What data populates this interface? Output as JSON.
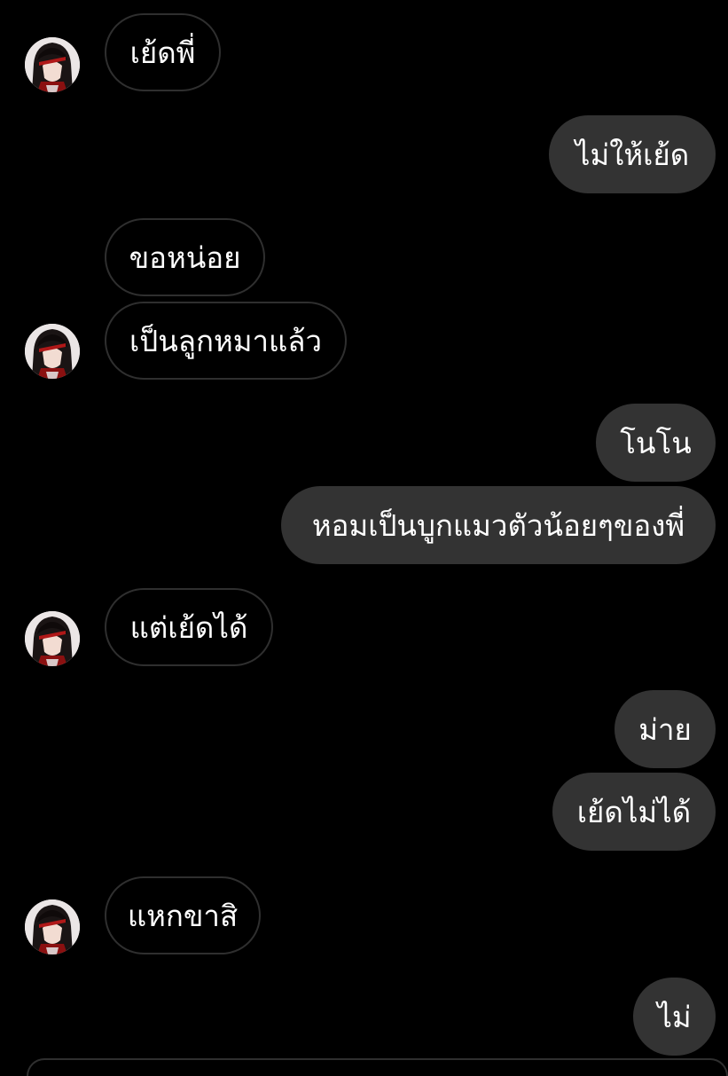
{
  "conversation": {
    "messages": [
      {
        "sender": "them",
        "text": "เย้ดพี่"
      },
      {
        "sender": "me",
        "text": "ไม่ให้เย้ด"
      },
      {
        "sender": "them",
        "text": "ขอหน่อย"
      },
      {
        "sender": "them",
        "text": "เป็นลูกหมาแล้ว"
      },
      {
        "sender": "me",
        "text": "โนโน"
      },
      {
        "sender": "me",
        "text": "หอมเป็นบูกแมวตัวน้อยๆของพี่"
      },
      {
        "sender": "them",
        "text": "แต่เย้ดได้"
      },
      {
        "sender": "me",
        "text": "ม่าย"
      },
      {
        "sender": "me",
        "text": "เย้ดไม่ได้"
      },
      {
        "sender": "them",
        "text": "แหกขาสิ"
      },
      {
        "sender": "me",
        "text": "ไม่"
      }
    ]
  },
  "colors": {
    "background": "#000000",
    "outgoing_bubble": "#333333",
    "incoming_border": "#2f2f2f",
    "text": "#ffffff"
  },
  "icons": {
    "avatar": "anime-character-avatar"
  }
}
